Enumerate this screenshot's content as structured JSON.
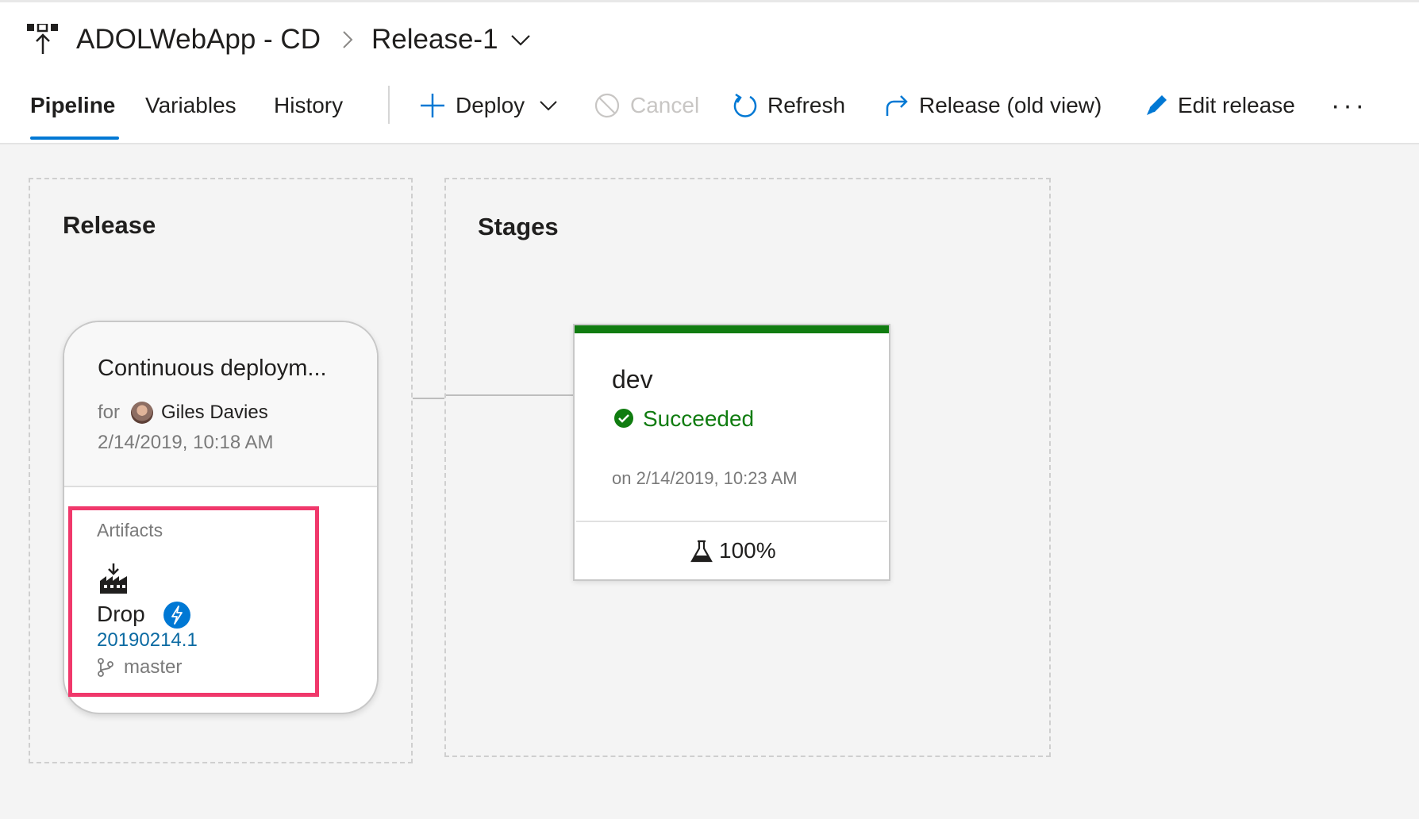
{
  "breadcrumb": {
    "pipeline_name": "ADOLWebApp - CD",
    "release_name": "Release-1"
  },
  "tabs": [
    {
      "label": "Pipeline",
      "active": true
    },
    {
      "label": "Variables",
      "active": false
    },
    {
      "label": "History",
      "active": false
    }
  ],
  "toolbar": {
    "deploy_label": "Deploy",
    "cancel_label": "Cancel",
    "refresh_label": "Refresh",
    "old_view_label": "Release (old view)",
    "edit_label": "Edit release",
    "more_label": "···"
  },
  "release_section": {
    "title": "Release",
    "card": {
      "name": "Continuous deploym...",
      "for_label": "for",
      "user": "Giles Davies",
      "date": "2/14/2019, 10:18 AM",
      "artifacts_label": "Artifacts",
      "artifact": {
        "name": "Drop",
        "version": "20190214.1",
        "branch": "master"
      }
    }
  },
  "stages_section": {
    "title": "Stages",
    "stages": [
      {
        "name": "dev",
        "status": "Succeeded",
        "status_color": "#107c10",
        "date": "on 2/14/2019, 10:23 AM",
        "tests": "100%"
      }
    ]
  },
  "colors": {
    "accent": "#0078d4",
    "success": "#107c10",
    "highlight": "#f0386b",
    "link": "#0b6aa2"
  },
  "icons": [
    "pipeline-icon",
    "chevron-right-icon",
    "chevron-down-icon",
    "plus-icon",
    "cancel-icon",
    "refresh-icon",
    "redo-arrow-icon",
    "pencil-icon",
    "build-artifact-icon",
    "lightning-icon",
    "branch-icon",
    "check-circle-icon",
    "flask-icon"
  ]
}
